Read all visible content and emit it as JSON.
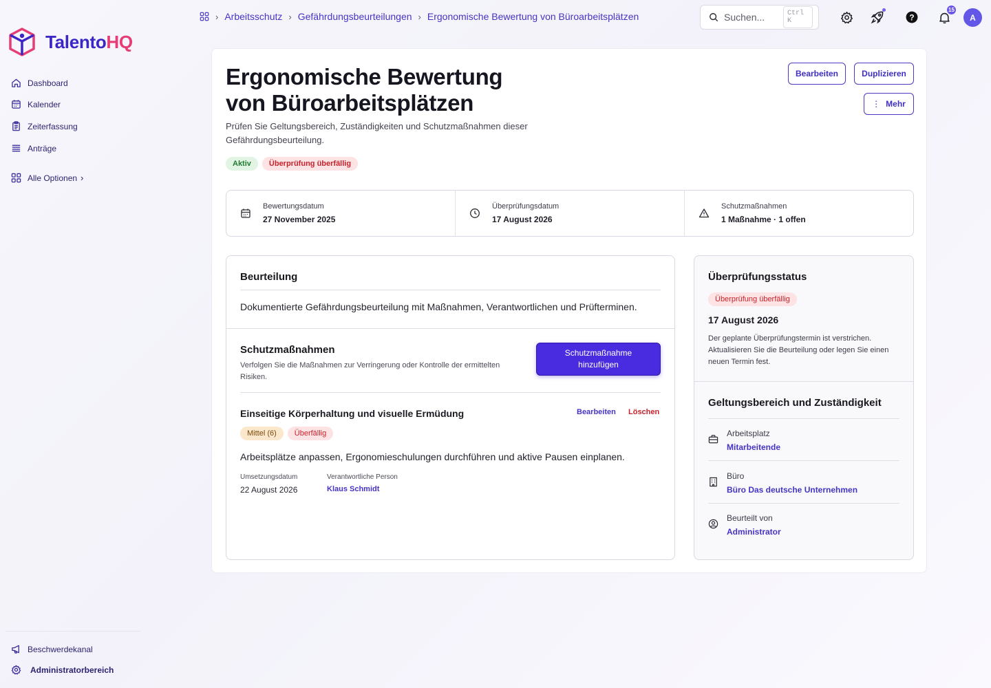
{
  "app": {
    "logo_primary": "Talento",
    "logo_accent": "HQ",
    "brand_color": "#3b27c4",
    "accent_color": "#e53d74"
  },
  "sidebar": {
    "items": [
      {
        "label": "Dashboard",
        "icon": "home-icon"
      },
      {
        "label": "Kalender",
        "icon": "calendar-icon"
      },
      {
        "label": "Zeiterfassung",
        "icon": "clipboard-icon"
      },
      {
        "label": "Anträge",
        "icon": "list-icon"
      },
      {
        "label": "Alle Optionen",
        "icon": "grid-icon"
      }
    ],
    "all_options_chevron": "›",
    "footer": [
      {
        "label": "Beschwerdekanal",
        "icon": "megaphone-icon"
      },
      {
        "label": "Administratorbereich",
        "icon": "gear-icon"
      }
    ]
  },
  "breadcrumb": [
    "Arbeitsschutz",
    "Gefährdungsbeurteilungen",
    "Ergonomische Bewertung von Büroarbeitsplätzen"
  ],
  "search": {
    "placeholder": "Suchen...",
    "shortcut": "Ctrl K"
  },
  "topbar": {
    "notification_count": "15",
    "avatar_initial": "A"
  },
  "page": {
    "title": "Ergonomische Bewertung von Büroarbeitsplätzen",
    "subtitle": "Prüfen Sie Geltungsbereich, Zuständigkeiten und Schutzmaßnahmen dieser Gefährdungsbeurteilung.",
    "status_active": "Aktiv",
    "status_overdue": "Überprüfung überfällig",
    "edit_label": "Bearbeiten",
    "duplicate_label": "Duplizieren",
    "more_label": "Mehr",
    "more_glyph": "⋮"
  },
  "stats": [
    {
      "label": "Bewertungsdatum",
      "value": "27 November 2025",
      "icon": "calendar-icon"
    },
    {
      "label": "Überprüfungsdatum",
      "value": "17 August 2026",
      "icon": "clock-icon"
    },
    {
      "label": "Schutzmaßnahmen",
      "value": "1 Maßnahme · 1 offen",
      "icon": "warning-icon"
    }
  ],
  "assessment": {
    "title": "Beurteilung",
    "description": "Dokumentierte Gefährdungsbeurteilung mit Maßnahmen, Verantwortlichen und Prüfterminen."
  },
  "measures": {
    "title": "Schutzmaßnahmen",
    "description": "Verfolgen Sie die Maßnahmen zur Verringerung oder Kontrolle der ermittelten Risiken.",
    "add_label": "Schutzmaßnahme hinzufügen",
    "items": [
      {
        "title": "Einseitige Körperhaltung und visuelle Ermüdung",
        "edit_label": "Bearbeiten",
        "delete_label": "Löschen",
        "risk_badge": "Mittel (6)",
        "status_badge": "Überfällig",
        "description": "Arbeitsplätze anpassen, Ergonomieschulungen durchführen und aktive Pausen einplanen.",
        "due_label": "Umsetzungsdatum",
        "due_value": "22 August 2026",
        "owner_label": "Verantwortliche Person",
        "owner_value": "Klaus Schmidt"
      }
    ]
  },
  "review": {
    "title": "Überprüfungsstatus",
    "badge": "Überprüfung überfällig",
    "date": "17 August 2026",
    "note": "Der geplante Überprüfungstermin ist verstrichen. Aktualisieren Sie die Beurteilung oder legen Sie einen neuen Termin fest."
  },
  "scope": {
    "title": "Geltungsbereich und Zuständigkeit",
    "items": [
      {
        "label": "Arbeitsplatz",
        "value": "Mitarbeitende",
        "icon": "briefcase-icon"
      },
      {
        "label": "Büro",
        "value": "Büro Das deutsche Unternehmen",
        "icon": "building-icon"
      },
      {
        "label": "Beurteilt von",
        "value": "Administrator",
        "icon": "user-circle-icon"
      }
    ]
  }
}
